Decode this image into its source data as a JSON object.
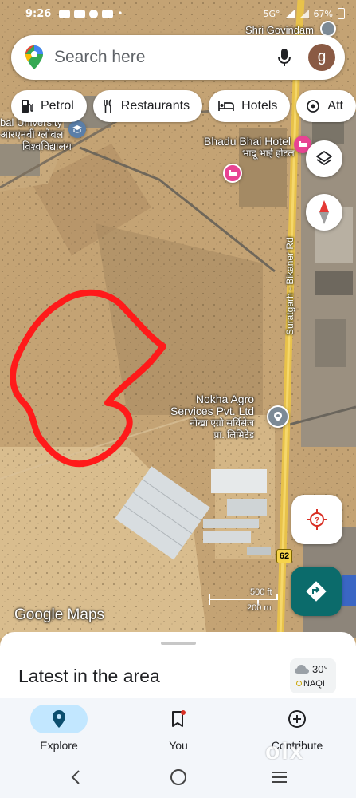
{
  "status_bar": {
    "time": "9:26",
    "network": "5G°",
    "battery": "67%",
    "top_place": "Shri Govindam"
  },
  "search": {
    "placeholder": "Search here",
    "avatar_letter": "g"
  },
  "chips": [
    {
      "label": "Petrol",
      "icon": "fuel-pump-icon"
    },
    {
      "label": "Restaurants",
      "icon": "fork-knife-icon"
    },
    {
      "label": "Hotels",
      "icon": "bed-icon"
    },
    {
      "label": "Att",
      "icon": "attraction-icon"
    }
  ],
  "map": {
    "labels": {
      "university_en": "bal University",
      "university_hi_1": "आरएनबी ग्लोबल",
      "university_hi_2": "विश्वविद्यालय",
      "hotel_en": "Bhadu Bhai Hotel",
      "hotel_hi": "भादू भाई होटल",
      "road": "Suratgarh - Bikaner Rd",
      "nokha_en_1": "Nokha Agro",
      "nokha_en_2": "Services Pvt. Ltd",
      "nokha_hi_1": "नोखा एग्रो सर्विसेज",
      "nokha_hi_2": "प्रा. लिमिटेड",
      "route_number": "62"
    },
    "scale": {
      "feet": "500 ft",
      "meters": "200 m"
    },
    "logo": "Google Maps",
    "colors": {
      "annotation": "#ff1a1a",
      "directions": "#0b6b6b",
      "road": "#e8c24a"
    }
  },
  "sheet": {
    "title": "Latest in the area",
    "weather_temp": "30°",
    "aqi": "NAQI"
  },
  "nav": {
    "explore": "Explore",
    "you": "You",
    "contribute": "Contribute"
  },
  "watermark": "olx"
}
